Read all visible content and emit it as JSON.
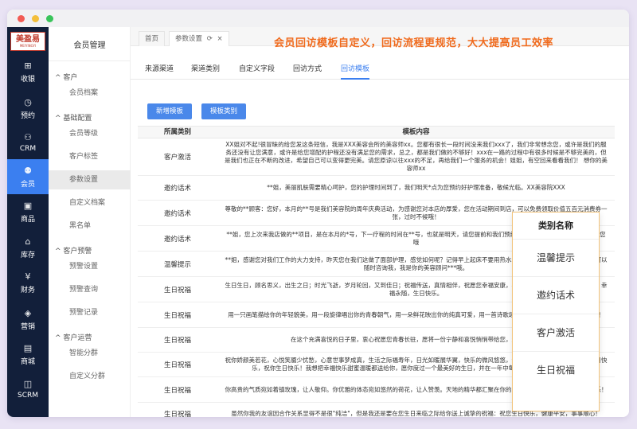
{
  "window": {
    "traffic_lights": [
      "#f25c54",
      "#f4bf3a",
      "#39c45a"
    ]
  },
  "logo": {
    "main": "美盈易",
    "sub": "MEIYINGYI"
  },
  "nav": [
    {
      "label": "收银",
      "icon": "cashier-icon"
    },
    {
      "label": "预约",
      "icon": "clock-icon"
    },
    {
      "label": "CRM",
      "icon": "crm-icon"
    },
    {
      "label": "会员",
      "icon": "member-icon",
      "active": true
    },
    {
      "label": "商品",
      "icon": "goods-icon"
    },
    {
      "label": "库存",
      "icon": "inventory-icon"
    },
    {
      "label": "财务",
      "icon": "finance-icon"
    },
    {
      "label": "营销",
      "icon": "marketing-icon"
    },
    {
      "label": "商城",
      "icon": "mall-icon"
    },
    {
      "label": "SCRM",
      "icon": "scrm-icon"
    }
  ],
  "submenu": {
    "title": "会员管理",
    "groups": [
      {
        "label": "客户",
        "items": [
          "会员档案"
        ]
      },
      {
        "label": "基础配置",
        "items": [
          "会员等级",
          "客户标签",
          "参数设置",
          "自定义档案",
          "黑名单"
        ]
      },
      {
        "label": "客户预警",
        "items": [
          "预警设置",
          "预警查询",
          "预警记录"
        ]
      },
      {
        "label": "客户运营",
        "items": [
          "智能分群",
          "自定义分群"
        ]
      }
    ],
    "active_item": "参数设置"
  },
  "page_tabs": [
    {
      "label": "首页"
    },
    {
      "label": "参数设置",
      "active": true,
      "refresh_icon": "refresh-icon",
      "close": "×"
    }
  ],
  "promo_text": "会员回访模板自定义，回访流程更规范，大大提高员工效率",
  "sub_tabs": [
    {
      "label": "来源渠道"
    },
    {
      "label": "渠道类别"
    },
    {
      "label": "自定义字段"
    },
    {
      "label": "回访方式"
    },
    {
      "label": "回访模板",
      "active": true
    }
  ],
  "buttons": {
    "add_template": "新增模板",
    "template_category": "模板类别"
  },
  "table": {
    "headers": [
      "所属类别",
      "模板内容"
    ],
    "rows": [
      {
        "category": "客户激活",
        "content": "XX姐对不起!很冒昧的给您发这条短信，我是XXX美容会所的美容师xx。您都有很长一段时间没来我们xxx了，我们非常想念您，或许是我们的服务还没有让您满意，或许是给您增配的护程还没有满足您的需求，总之，都是我们做的不够好！xxx在一路的过程中有很多时候是不够完美的，但是我们也正在不断的改进，希望自己可以变得更完美。请您原谅以往xxx的不足，再给我们一个服务的机会！姐姐，有空回来看看我们！ 想你的美容师xx",
        "h": 47
      },
      {
        "category": "邀约话术",
        "content": "**姐，美丽肌肤需要精心呵护，您的护理时间到了，我们明天*点为您预约好护理准备，敬候光临。XX美容院XXX",
        "h": 31
      },
      {
        "category": "邀约话术",
        "content": "尊敬的**顾客：您好，本月的**号是我们美容院的周年庆典活动，为感谢您对本店的厚爱，您在活动期间到店，可以免费领取价值五百元消费券一张，过时不候哦！",
        "h": 32
      },
      {
        "category": "邀约话术",
        "content": "**姐，您上次来我店做的**项目，是在本月的*号，下一疗程的时间在**号，也就是明天，请您提前和我们预约，姐，我们有专业的美容师等着您哦",
        "h": 32
      },
      {
        "category": "温馨提示",
        "content": "**姐，感谢您对我们工作的大力支持，昨天您在我们这做了面部护理，感觉如何呢？记得早上起床不要用热水洗脸，姐，如果您有任何问题，可以随时咨询我，我是你的美容顾问***哦。",
        "h": 32
      },
      {
        "category": "生日祝福",
        "content": "生日生日，顾名思义，出生之日；时光飞逝，岁月轮回，又到佳日；祝福传送，真情相伴，祝愿您幸福安康，事事顺心，万事如意，好运环围，幸福永随，生日快乐。",
        "h": 32
      },
      {
        "category": "生日祝福",
        "content": "用一只画笔描绘你的年轻貌美，用一段旋律唱出你的青春朝气，用一朵鲜花映出你的纯真可爱，用一首诗歌颂出你的美好未来，祝你生日快乐！",
        "h": 32
      },
      {
        "category": "生日祝福",
        "content": "在这个充满喜悦的日子里，衷心祝愿您青春长驻，愿将一份宁静和喜悦悄悄带给您，生日快乐！",
        "h": 31
      },
      {
        "category": "生日祝福",
        "content": "祝你娇颜美若花，心悦笑靥少忧愁，心意世事梦成真，生活之际福寿年，日光如暖展华翼，快乐的微风悠悠，幸福的花香悠悠，今天是你的生日快乐，祝你生日快乐！我想把幸福快乐甜蜜温暖都送给你，愿你度过一个最美好的生日，并在一年中每一天都像今天一样快乐！",
        "h": 31
      },
      {
        "category": "生日祝福",
        "content": "你高贵的气质宛如着镇玫瑰，让人敬仰。你优雅的体态宛如悠然的荷花，让人赞羡。天地的精华都汇聚在你的身上，在你生日之际，祝生日快乐！",
        "h": 32
      },
      {
        "category": "生日祝福",
        "content": "虽然你我的友谊因合作关系显得不是很\"纯洁\"，但是我还是要在您生日来临之际给你送上诚挚的祝福：祝您生日快乐，健康平安，事事顺心！",
        "h": 28
      }
    ]
  },
  "popup": {
    "header": "类别名称",
    "items": [
      "温馨提示",
      "邀约话术",
      "客户激活",
      "生日祝福"
    ]
  }
}
